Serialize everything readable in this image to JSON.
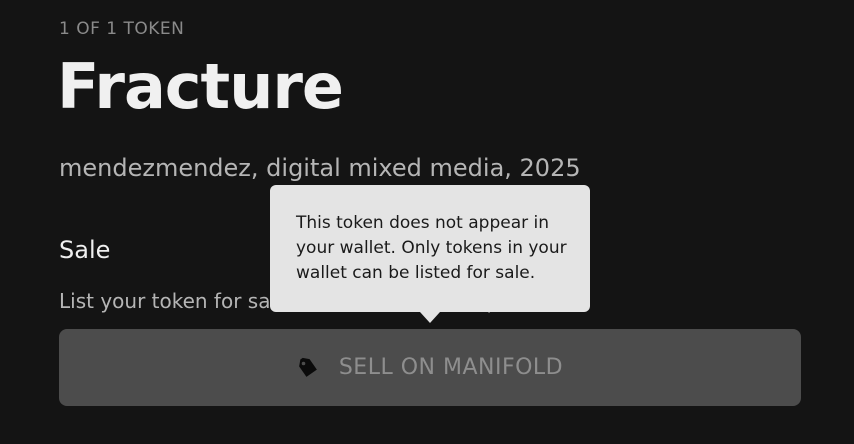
{
  "token": {
    "edition": "1 OF 1 TOKEN",
    "title": "Fracture",
    "meta": "mendezmendez, digital mixed media, 2025"
  },
  "sale": {
    "heading": "Sale",
    "description": "List your token for sale on Manifold Marketplace",
    "button": {
      "label": "SELL ON MANIFOLD",
      "icon": "tag-icon",
      "state": "disabled"
    }
  },
  "tooltip": {
    "text": "This token does not appear in your wallet. Only tokens in your wallet can be listed for sale."
  },
  "colors": {
    "background": "#141414",
    "button": "#4c4c4c",
    "tooltip": "#e4e4e4"
  }
}
